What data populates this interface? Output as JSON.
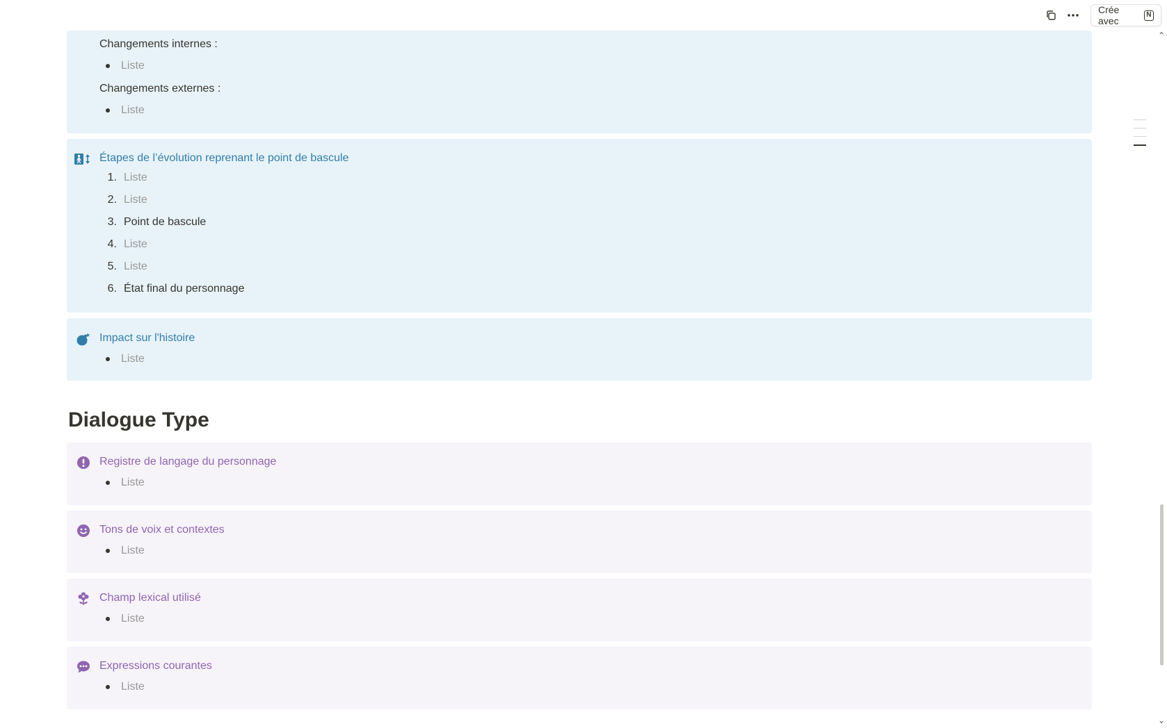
{
  "topbar": {
    "cree_avec_label": "Crée avec",
    "notion_logo_letter": "N"
  },
  "callouts_top": {
    "changes": {
      "internal_label": "Changements internes :",
      "internal_items": [
        "Liste"
      ],
      "external_label": "Changements externes :",
      "external_items": [
        "Liste"
      ]
    },
    "steps": {
      "icon": "evolution-arrows-icon",
      "title": "Étapes de l’évolution reprenant le point de bascule",
      "items": [
        {
          "num": "1.",
          "text": "Liste"
        },
        {
          "num": "2.",
          "text": "Liste"
        },
        {
          "num": "3.",
          "text": "Point de bascule"
        },
        {
          "num": "4.",
          "text": "Liste"
        },
        {
          "num": "5.",
          "text": "Liste"
        },
        {
          "num": "6.",
          "text": "État final du personnage"
        }
      ]
    },
    "impact": {
      "icon": "bomb-icon",
      "title": "Impact sur l'histoire",
      "items": [
        "Liste"
      ]
    }
  },
  "dialogue": {
    "heading": "Dialogue Type",
    "callouts": [
      {
        "icon": "exclamation-icon",
        "title": "Registre de langage du personnage",
        "item": "Liste"
      },
      {
        "icon": "smiley-icon",
        "title": "Tons de voix et contextes",
        "item": "Liste"
      },
      {
        "icon": "flower-icon",
        "title": "Champ lexical utilisé",
        "item": "Liste"
      },
      {
        "icon": "speech-bubble-icon",
        "title": "Expressions courantes",
        "item": "Liste"
      }
    ]
  },
  "colors": {
    "blue_callout_bg": "#e7f3f8",
    "blue_text": "#337ea9",
    "purple_callout_bg": "#f6f3f9",
    "purple_text": "#9065b0",
    "placeholder": "#9b9a97"
  }
}
